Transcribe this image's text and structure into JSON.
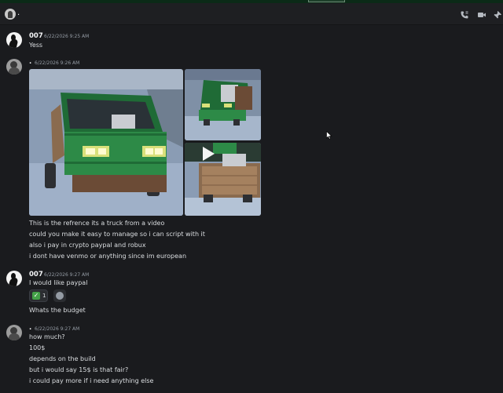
{
  "header": {
    "channel_name": ".",
    "icons": [
      "voice-call-icon",
      "video-call-icon",
      "pin-icon"
    ]
  },
  "messages": [
    {
      "author": "007",
      "timestamp": "6/22/2026 9:25 AM",
      "lines": [
        "Yess"
      ]
    },
    {
      "author": ".",
      "timestamp": "6/22/2026 9:26 AM",
      "attachments": [
        "truck-front-image",
        "truck-side-image",
        "truck-bed-video"
      ],
      "lines": [
        "This is the refrence its a truck from a video",
        "could you make it easy to manage so i can script with it",
        "also i pay in crypto paypal and robux",
        "i dont have venmo or anything since im european"
      ]
    },
    {
      "author": "007",
      "timestamp": "6/22/2026 9:27 AM",
      "lines": [
        "I would like paypal"
      ],
      "reaction": {
        "emoji": "check-mark-emoji",
        "count": "1"
      },
      "after_lines": [
        "Whats the budget"
      ]
    },
    {
      "author": ".",
      "timestamp": "6/22/2026 9:27 AM",
      "lines": [
        "how much?",
        "100$",
        "depends on the build",
        "but i would say 15$ is that fair?",
        "i could pay more if i need anything else"
      ]
    }
  ],
  "colors": {
    "background": "#1a1b1e",
    "header": "#1e1f22",
    "top_strip": "#0b2a17",
    "text": "#dbdee1",
    "timestamp": "#949ba4",
    "reaction_green": "#43a047"
  }
}
